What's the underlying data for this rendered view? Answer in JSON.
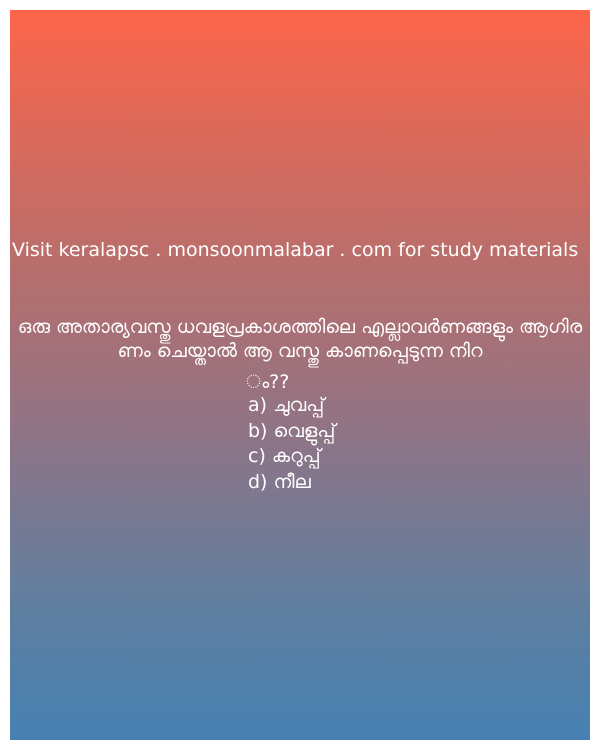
{
  "site_text": "Visit keralapsc . monsoonmalabar . com for study materials",
  "question": {
    "text": "ഒരു അതാര്യവസ്തു ധവളപ്രകാശത്തിലെ എല്ലാവർണങ്ങളും ആഗിരണം ചെയ്താൽ ആ വസ്തു കാണപ്പെടുന്ന നിറ",
    "tail": "ം??"
  },
  "options": [
    {
      "letter": "a)",
      "text": "ചുവപ്പ്"
    },
    {
      "letter": "b)",
      "text": "വെളുപ്പ്"
    },
    {
      "letter": "c)",
      "text": "കറുപ്പ്"
    },
    {
      "letter": "d)",
      "text": "നീല"
    }
  ],
  "colors": {
    "gradient_top": "#fd654a",
    "gradient_bottom": "#4680b2",
    "text": "#ffffff"
  }
}
